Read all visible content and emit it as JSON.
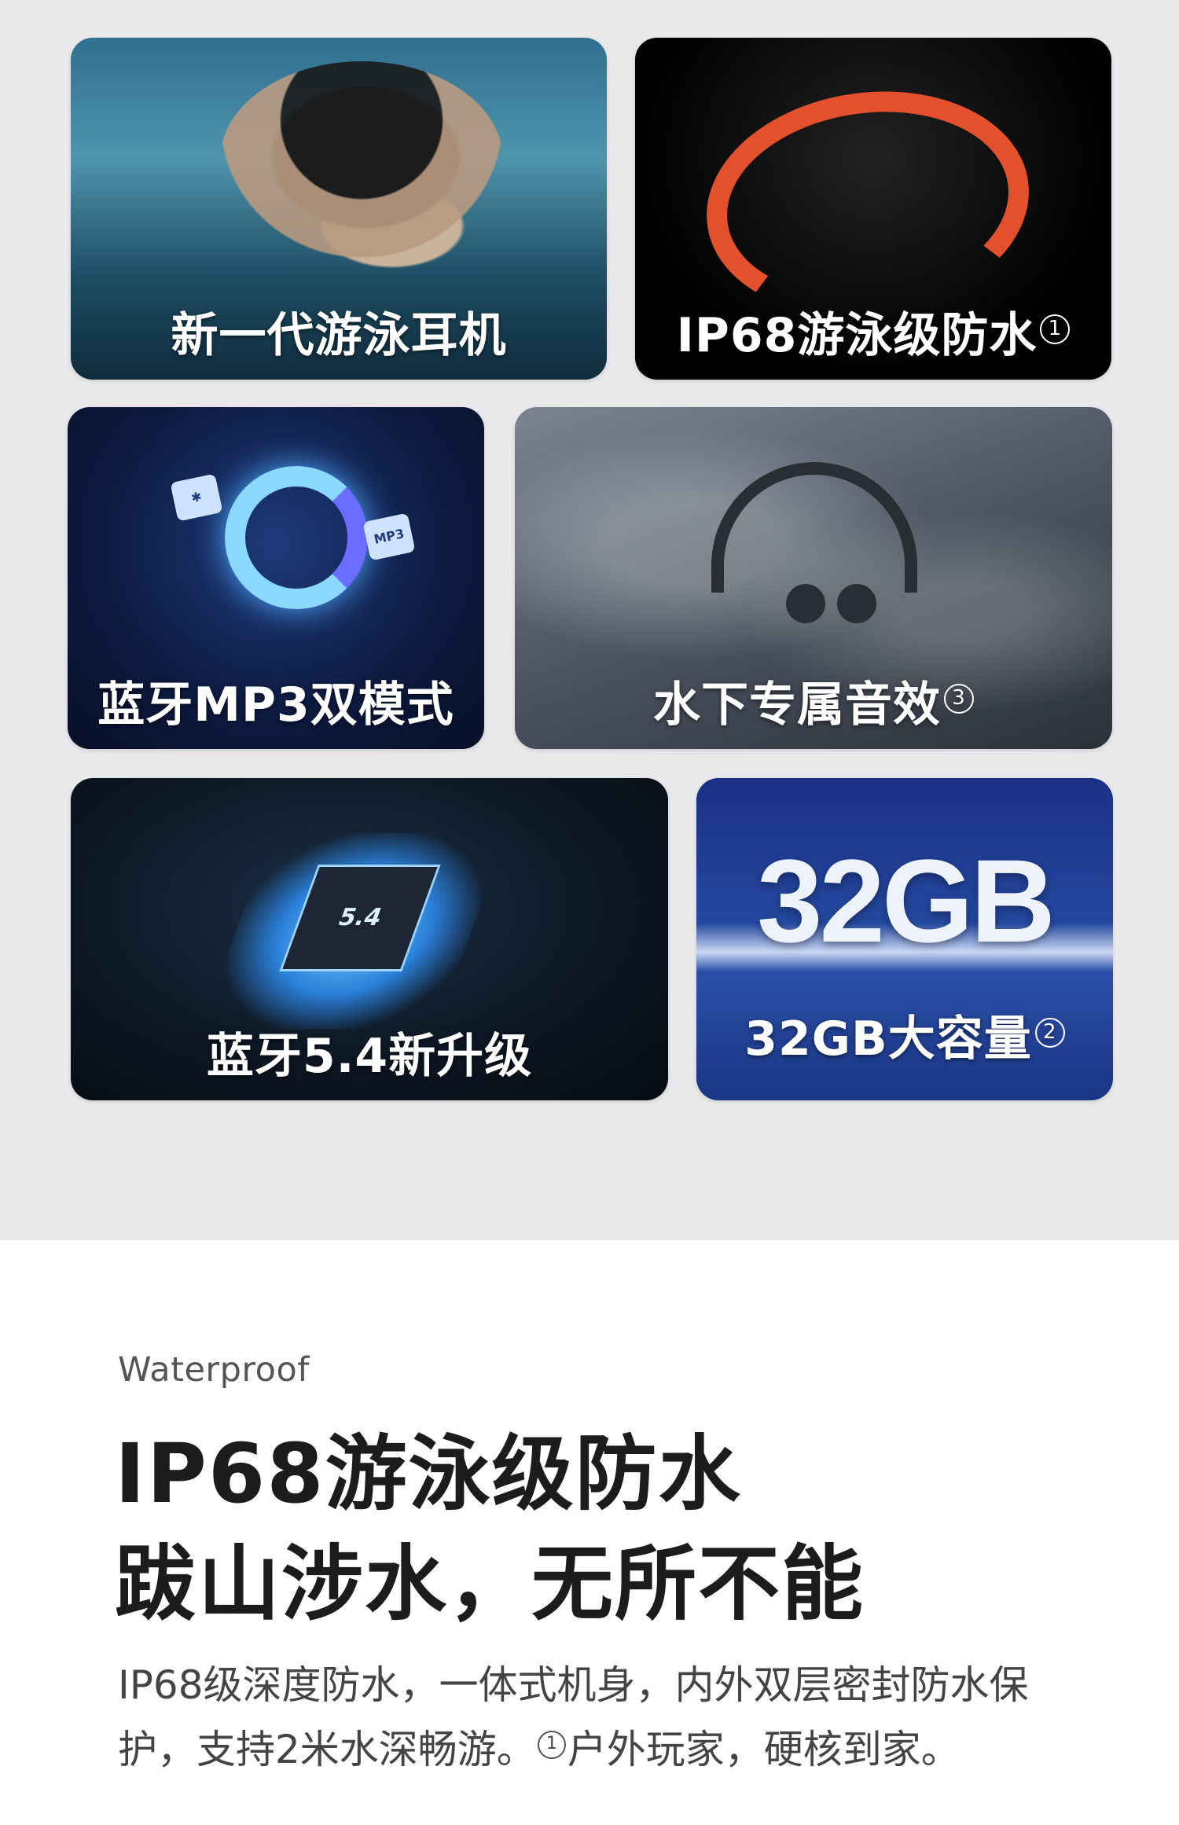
{
  "tiles": [
    {
      "caption": "新一代游泳耳机",
      "note": ""
    },
    {
      "caption": "IP68游泳级防水",
      "note": "1"
    },
    {
      "caption": "蓝牙MP3双模式",
      "note": "",
      "badges": [
        "MP3"
      ]
    },
    {
      "caption": "水下专属音效",
      "note": "3"
    },
    {
      "caption": "蓝牙5.4新升级",
      "note": "",
      "chip_label": "5.4"
    },
    {
      "caption": "32GB大容量",
      "note": "2",
      "big_text": "32GB"
    }
  ],
  "content": {
    "eyebrow": "Waterproof",
    "headline_1": "IP68游泳级防水",
    "headline_2": "跋山涉水，无所不能",
    "body_part1": "IP68级深度防水，一体式机身，内外双层密封防水保护，支持2米水深畅游。",
    "footnote": "1",
    "body_part2": "户外玩家，硬核到家。"
  }
}
